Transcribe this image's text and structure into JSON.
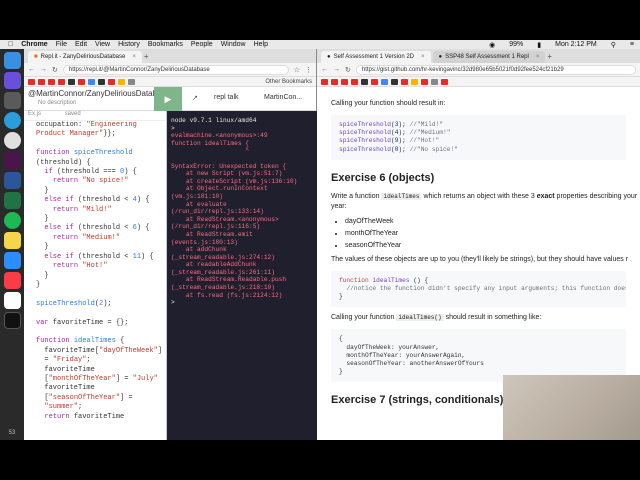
{
  "menubar": {
    "app": "Chrome",
    "items": [
      "File",
      "Edit",
      "View",
      "History",
      "Bookmarks",
      "People",
      "Window",
      "Help"
    ],
    "battery": "99%",
    "clock": "Mon 2:12 PM"
  },
  "dock": {
    "line_number": "53",
    "icons": [
      "finder-icon",
      "siri-icon",
      "launchpad-icon",
      "safari-icon",
      "chrome-icon",
      "slack-icon",
      "word-icon",
      "excel-icon",
      "spotify-icon",
      "notes-icon",
      "zoom-icon",
      "music-icon",
      "calendar-icon",
      "terminal-icon"
    ]
  },
  "left_window": {
    "tab_label": "Repl.it - ZanyDeliriousDatabase",
    "url": "https://repl.it/@MartinConnor/ZanyDeliriousDatabase",
    "bookmarks_other": "Other Bookmarks",
    "project_name": "@MartinConnor/ZanyDeliriousDatabase",
    "description": "No description",
    "share_label": "share",
    "talk_label": "repl talk",
    "user_label": "MartinCon...",
    "editor_file": "Ex.js",
    "editor_status": "saved",
    "console_header": "node v9.7.1 linux/amd64",
    "console_prompt": ">"
  },
  "right_window": {
    "tab1_label": "Self Assessment 1 Version 2D",
    "tab2_label": "SSP48 Self Assessment 1 Repl",
    "url": "https://gist.github.com/hr-kevingavinc/32d980e65b5021f0d92fee524cf21b29",
    "text_result_intro": "Calling your function should result in:",
    "heading_ex6": "Exercise 6 (objects)",
    "ex6_text_a": "Write a function",
    "ex6_code_name": "idealTimes",
    "ex6_text_b": "which returns an object with these 3",
    "ex6_text_exact": "exact",
    "ex6_text_c": "properties describing your",
    "ex6_text_d": "year:",
    "properties": [
      "dayOfTheWeek",
      "monthOfTheYear",
      "seasonOfTheYear"
    ],
    "values_text": "The values of these objects are up to you (they'll likely be strings), but they should have values r",
    "calling_text_a": "Calling your function",
    "calling_code": "idealTimes()",
    "calling_text_b": "should result in something like:",
    "heading_ex7": "Exercise 7 (strings, conditionals)"
  }
}
